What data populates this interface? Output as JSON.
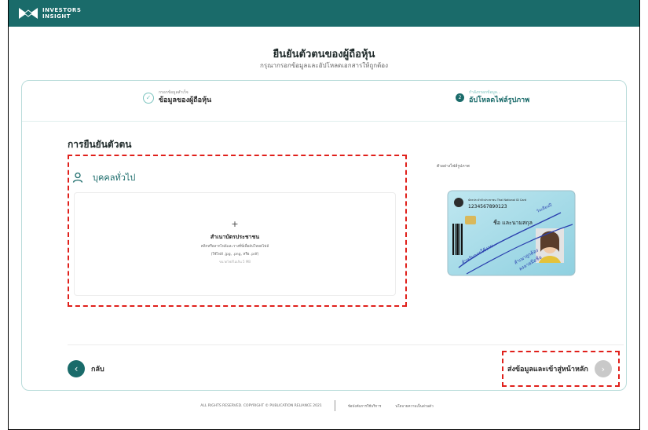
{
  "brand": {
    "line1": "INVESTORS",
    "line2": "INSIGHT",
    "color": "#1a6b6a"
  },
  "header": {
    "title": "ยืนยันตัวตนของผู้ถือหุ้น",
    "subtitle": "กรุณากรอกข้อมูลและอัปโหลดเอกสารให้ถูกต้อง"
  },
  "steps": [
    {
      "small": "กรอกข้อมูลสำเร็จ",
      "label": "ข้อมูลของผู้ถือหุ้น",
      "status": "done",
      "icon": "check-icon"
    },
    {
      "small": "กำลังกรอกข้อมูล...",
      "label": "อัปโหลดไฟล์รูปภาพ",
      "status": "current",
      "number": "2"
    }
  ],
  "section": {
    "title": "การยืนยันตัวตน"
  },
  "person": {
    "label": "บุคคลทั่วไป",
    "icon": "user-icon"
  },
  "upload": {
    "plus": "+",
    "title": "สำเนาบัตรประชาชน",
    "hint1": "คลิกหรือลากไฟล์และวางที่นี่เพื่ออัปโหลดไฟล์",
    "hint2": "(ใช้ไฟล์ .jpg, .png, หรือ .pdf)",
    "hint3": "ขนาดไฟล์ไม่เกิน 5 MB"
  },
  "sample": {
    "label": "ตัวอย่างไฟล์รูปภาพ",
    "card": {
      "header": "บัตรประจำตัวประชาชน Thai National ID Card",
      "number": "1234567890123",
      "name": "ชื่อ และนามสกุล",
      "watermark1": "สำหรับการใช้งาน...",
      "watermark2": "สำเนาถูกต้อง",
      "watermark3": "ลงลายมือชื่อ",
      "watermark4": "วันเดือนปี"
    }
  },
  "nav": {
    "back_label": "กลับ",
    "submit_label": "ส่งข้อมูลและเข้าสู่หน้าหลัก"
  },
  "footer": {
    "copyright": "ALL RIGHTS RESERVED. COPYRIGHT © PUBLICATION RELIANCE 2021",
    "link1": "ข้อบังคับการใช้บริการ",
    "link2": "นโยบายความเป็นส่วนตัว"
  }
}
